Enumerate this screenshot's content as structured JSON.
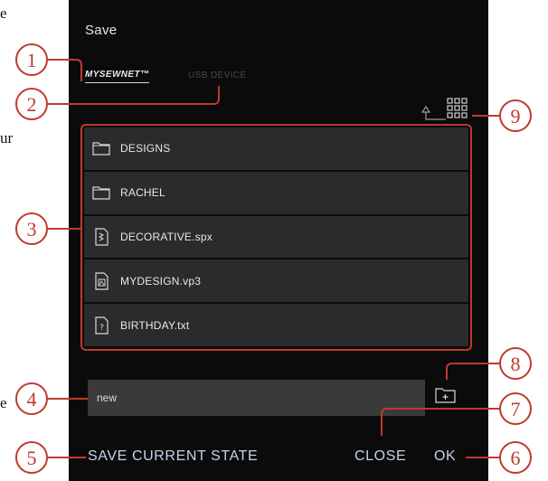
{
  "margin_text": [
    "e",
    "ur",
    "e"
  ],
  "dialog": {
    "title": "Save",
    "tabs": [
      {
        "label": "MYSEWNET™",
        "active": true
      },
      {
        "label": "USB DEVICE",
        "active": false
      }
    ],
    "icons": {
      "back": "back-arrow-icon",
      "view": "grid-view-icon",
      "new_folder": "new-folder-icon"
    },
    "files": [
      {
        "name": "DESIGNS",
        "icon": "folder-icon"
      },
      {
        "name": "RACHEL",
        "icon": "folder-icon"
      },
      {
        "name": "DECORATIVE.spx",
        "icon": "stitch-file-icon"
      },
      {
        "name": "MYDESIGN.vp3",
        "icon": "embroidery-file-icon"
      },
      {
        "name": "BIRTHDAY.txt",
        "icon": "unknown-file-icon"
      }
    ],
    "filename_value": "new",
    "actions": {
      "save_state": "SAVE CURRENT STATE",
      "close": "CLOSE",
      "ok": "OK"
    }
  },
  "callouts": [
    "1",
    "2",
    "3",
    "4",
    "5",
    "6",
    "7",
    "8",
    "9"
  ],
  "colors": {
    "dialog_bg": "#0b0b0b",
    "row_bg": "#2b2b2b",
    "action_text": "#bfd6ec",
    "callout": "#c0392b"
  }
}
